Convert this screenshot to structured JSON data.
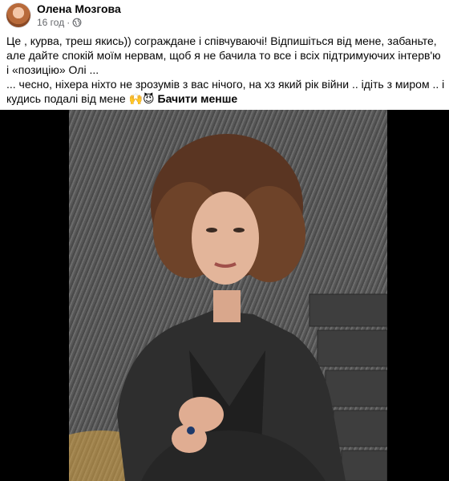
{
  "post": {
    "author": "Олена Мозгова",
    "time": "16 год",
    "separator": "·",
    "privacy_icon": "globe-icon",
    "text_line_1": "Це , курва, треш якись)) сограждане і співчуваючі! Відпишіться від мене, забаньте, але дайте спокій моїм нервам, щоб я не бачила то все і всіх підтримуючих інтерв'ю і «позицію» Олі ...",
    "text_line_2": "... чесно, ніхера ніхто не зрозумів з вас нічого, на хз який рік війни .. ідіть з миром .. і кудись подалі від мене",
    "emojis": "🙌😈",
    "see_less": "Бачити менше"
  }
}
